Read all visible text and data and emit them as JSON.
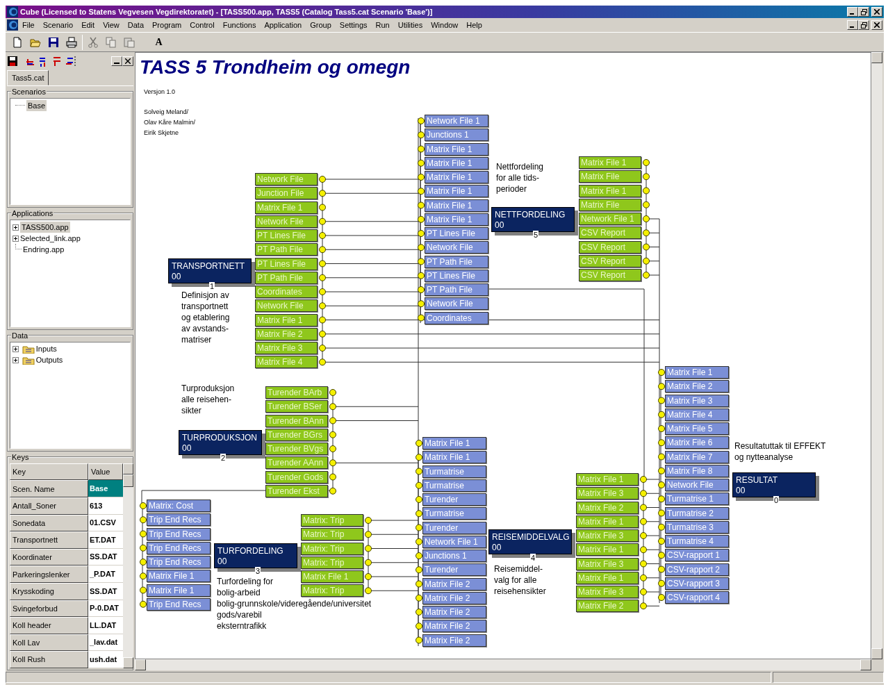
{
  "window": {
    "title": "Cube (Licensed to Statens Vegvesen Vegdirektoratet) - [TASS500.app, TASS5 (Catalog Tass5.cat Scenario 'Base')]"
  },
  "menu": [
    "File",
    "Scenario",
    "Edit",
    "View",
    "Data",
    "Program",
    "Control",
    "Functions",
    "Application",
    "Group",
    "Settings",
    "Run",
    "Utilities",
    "Window",
    "Help"
  ],
  "toolbar": {
    "buttons": [
      {
        "kind": "new",
        "disabled": false
      },
      {
        "kind": "open",
        "disabled": false
      },
      {
        "kind": "save",
        "disabled": false
      },
      {
        "kind": "print",
        "disabled": false
      },
      {
        "kind": "cut",
        "disabled": true
      },
      {
        "kind": "copy",
        "disabled": true
      },
      {
        "kind": "paste",
        "disabled": true
      }
    ],
    "font_label": "A"
  },
  "catalog_tab": "Tass5.cat",
  "scenarios": {
    "label": "Scenarios",
    "items": [
      {
        "label": "Base",
        "selected": true
      }
    ]
  },
  "applications": {
    "label": "Applications",
    "items": [
      {
        "label": "TASS500.app",
        "selected": true,
        "expandable": true
      },
      {
        "label": "Selected_link.app",
        "selected": false,
        "expandable": true
      },
      {
        "label": "Endring.app",
        "selected": false,
        "expandable": false
      }
    ]
  },
  "data": {
    "label": "Data",
    "items": [
      {
        "label": "Inputs"
      },
      {
        "label": "Outputs"
      }
    ]
  },
  "keys": {
    "label": "Keys",
    "columns": [
      "Key",
      "Value"
    ],
    "rows": [
      {
        "key": "Scen. Name",
        "value": "Base",
        "selected": true
      },
      {
        "key": "Antall_Soner",
        "value": "613",
        "selected": false
      },
      {
        "key": "Sonedata",
        "value": "01.CSV",
        "selected": false
      },
      {
        "key": "Transportnett",
        "value": "ET.DAT",
        "selected": false
      },
      {
        "key": "Koordinater",
        "value": "SS.DAT",
        "selected": false
      },
      {
        "key": "Parkeringslenker",
        "value": "_P.DAT",
        "selected": false
      },
      {
        "key": "Krysskoding",
        "value": "SS.DAT",
        "selected": false
      },
      {
        "key": "Svingeforbud",
        "value": "P-0.DAT",
        "selected": false
      },
      {
        "key": "Koll header",
        "value": "LL.DAT",
        "selected": false
      },
      {
        "key": "Koll Lav",
        "value": "_lav.dat",
        "selected": false
      },
      {
        "key": "Koll Rush",
        "value": "ush.dat",
        "selected": false
      }
    ]
  },
  "canvas": {
    "title": "TASS 5 Trondheim og omegn",
    "version": "Versjon 1.0",
    "authors": [
      "Solveig Meland/",
      "Olav Kåre Malmin/",
      "Eirik Skjetne"
    ],
    "modules": [
      {
        "name": "TRANSPORTNETT",
        "code": "00",
        "number": "1",
        "description": [
          "Definisjon av",
          "transportnett",
          "og etablering",
          "av avstands-",
          "matriser"
        ],
        "outputs": [
          "Network File",
          "Junction File",
          "Matrix File 1",
          "Network File",
          "PT Lines File",
          "PT Path File",
          "PT Lines File",
          "PT Path File",
          "Coordinates",
          "Network File",
          "Matrix File 1",
          "Matrix File 2",
          "Matrix File 3",
          "Matrix File 4"
        ]
      },
      {
        "name": "TURPRODUKSJON",
        "code": "00",
        "number": "2",
        "description": [
          "Turproduksjon",
          "alle reisehen-",
          "sikter"
        ],
        "outputs": [
          "Turender BArb",
          "Turender BSer",
          "Turender BAnn",
          "Turender BGrs",
          "Turender BVgs",
          "Turender AAnn",
          "Turender Gods",
          "Turender Ekst"
        ]
      },
      {
        "name": "TURFORDELING",
        "code": "00",
        "number": "3",
        "description": [
          "Turfordeling for",
          "bolig-arbeid",
          "bolig-grunnskole/videregående/universitet",
          "gods/varebil",
          "eksterntrafikk"
        ],
        "inputs": [
          "Matrix: Cost",
          "Trip End Recs",
          "Trip End Recs",
          "Trip End Recs",
          "Trip End Recs",
          "Matrix File 1",
          "Matrix File 1",
          "Trip End Recs"
        ],
        "outputs": [
          "Matrix: Trip",
          "Matrix: Trip",
          "Matrix: Trip",
          "Matrix: Trip",
          "Matrix File 1",
          "Matrix: Trip"
        ]
      },
      {
        "name": "NETTFORDELING",
        "code": "00",
        "number": "5",
        "description": [
          "Nettfordeling",
          "for alle tids-",
          "perioder"
        ],
        "inputs": [
          "Network File 1",
          "Junctions 1",
          "Matrix File 1",
          "Matrix File 1",
          "Matrix File 1",
          "Matrix File 1",
          "Matrix File 1",
          "Matrix File 1",
          "PT Lines File",
          "Network File",
          "PT Path File",
          "PT Lines File",
          "PT Path File",
          "Network File",
          "Coordinates"
        ],
        "outputs": [
          "Matrix File 1",
          "Matrix File",
          "Matrix File 1",
          "Matrix File",
          "Network File 1",
          "CSV Report",
          "CSV Report",
          "CSV Report",
          "CSV Report"
        ]
      },
      {
        "name": "REISEMIDDELVALG",
        "code": "00",
        "number": "4",
        "description": [
          "Reisemiddel-",
          "valg for alle",
          "reisehensikter"
        ],
        "inputs": [
          "Matrix File 1",
          "Matrix File 1",
          "Turmatrise",
          "Turmatrise",
          "Turender",
          "Turmatrise",
          "Turender",
          "Network File 1",
          "Junctions 1",
          "Turender",
          "Matrix File 2",
          "Matrix File 2",
          "Matrix File 2",
          "Matrix File 2",
          "Matrix File 2"
        ],
        "outputs": [
          "Matrix File 1",
          "Matrix File 3",
          "Matrix File 2",
          "Matrix File 1",
          "Matrix File 3",
          "Matrix File 1",
          "Matrix File 3",
          "Matrix File 1",
          "Matrix File 3",
          "Matrix File 2"
        ]
      },
      {
        "name": "RESULTAT",
        "code": "00",
        "number": "0",
        "description": [
          "Resultatuttak til EFFEKT",
          "og nytteanalyse"
        ],
        "inputs": [
          "Matrix File 1",
          "Matrix File 2",
          "Matrix File 3",
          "Matrix File 4",
          "Matrix File 5",
          "Matrix File 6",
          "Matrix File 7",
          "Matrix File 8",
          "Network File",
          "Turmatrise 1",
          "Turmatrise 2",
          "Turmatrise 3",
          "Turmatrise 4",
          "CSV-rapport 1",
          "CSV-rapport 2",
          "CSV-rapport 3",
          "CSV-rapport 4"
        ]
      }
    ]
  }
}
